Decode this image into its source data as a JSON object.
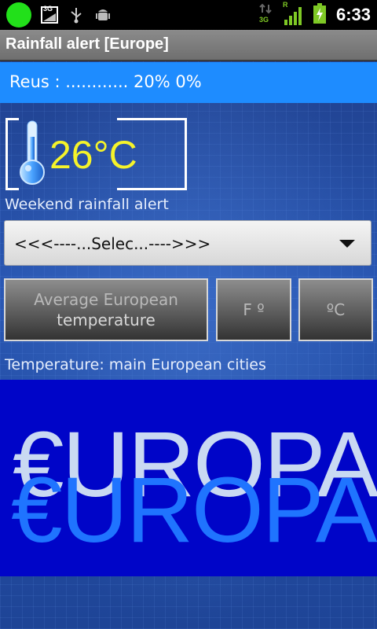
{
  "status_bar": {
    "network_type_left": "3G",
    "network_type_right": "3G",
    "roaming": "R",
    "time": "6:33",
    "icons": [
      "green-dot-icon",
      "data-icon",
      "usb-icon",
      "android-debug-icon",
      "data-transfer-icon",
      "signal-icon",
      "battery-charging-icon"
    ]
  },
  "app": {
    "title": "Rainfall alert [Europe]",
    "info_line": "Reus : ............ 20% 0%",
    "temperature": "26°C"
  },
  "main": {
    "weekend_label": "Weekend rainfall alert",
    "select_value": "<<<----...Selec...---->>>",
    "buttons": {
      "average_line1": "Average European",
      "average_line2": "temperature",
      "fahrenheit": "F º",
      "celsius": "ºC"
    },
    "cities_label": "Temperature: main European cities"
  },
  "banner": {
    "text_back": "€UROPA",
    "text_front": "€UROPA"
  },
  "colors": {
    "info_bar": "#1e8cff",
    "temperature_text": "#f5f32a",
    "banner_bg": "#0005c8",
    "banner_front_text": "#1f74ff",
    "banner_back_text": "#c9d9f2"
  }
}
